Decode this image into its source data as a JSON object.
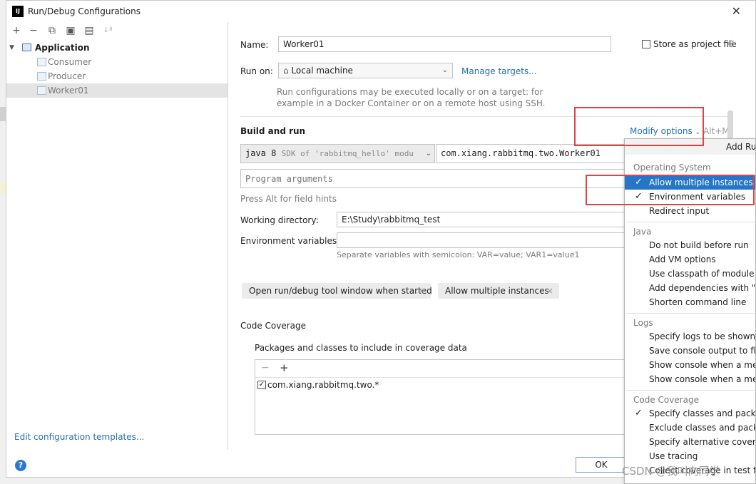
{
  "window": {
    "title": "Run/Debug Configurations",
    "app_icon_text": "IJ",
    "close": "✕"
  },
  "toolbar": {
    "add": "+",
    "remove": "−",
    "copy": "⧉",
    "save": "▣",
    "folder": "▤",
    "sort": "↓ª"
  },
  "tree": {
    "root": "Application",
    "children": [
      "Consumer",
      "Producer",
      "Worker01"
    ],
    "selected": "Worker01"
  },
  "edit_templates": "Edit configuration templates...",
  "form": {
    "name_label": "Name:",
    "name_value": "Worker01",
    "store_label": "Store as project file",
    "run_on_label": "Run on:",
    "run_on_value": "Local machine",
    "manage_targets": "Manage targets...",
    "run_on_hint_1": "Run configurations may be executed locally or on a target: for",
    "run_on_hint_2": "example in a Docker Container or on a remote host using SSH.",
    "build_run_label": "Build and run",
    "modify_options": "Modify options",
    "modify_shortcut": "Alt+M",
    "jdk_value": "java 8",
    "jdk_detail": "SDK of 'rabbitmq_hello' modu",
    "main_class": "com.xiang.rabbitmq.two.Worker01",
    "program_args_placeholder": "Program arguments",
    "alt_hint": "Press Alt for field hints",
    "working_dir_label": "Working directory:",
    "working_dir_value": "E:\\Study\\rabbitmq_test",
    "env_label": "Environment variables:",
    "env_hint": "Separate variables with semicolon: VAR=value; VAR1=value1",
    "chip_1": "Open run/debug tool window when started",
    "chip_2": "Allow multiple instances",
    "chip_close": "×",
    "code_coverage_label": "Code Coverage",
    "coverage_packages_label": "Packages and classes to include in coverage data",
    "coverage_remove": "−",
    "coverage_add": "+",
    "coverage_item": "com.xiang.rabbitmq.two.*",
    "ok": "OK",
    "help": "?"
  },
  "popup": {
    "header": "Add Run",
    "groups": [
      {
        "title": "Operating System",
        "items": [
          {
            "label": "Allow multiple instances",
            "checked": true,
            "selected": true
          },
          {
            "label": "Environment variables",
            "checked": true,
            "selected": false
          },
          {
            "label": "Redirect input",
            "checked": false,
            "selected": false
          }
        ]
      },
      {
        "title": "Java",
        "items": [
          {
            "label": "Do not build before run",
            "checked": false
          },
          {
            "label": "Add VM options",
            "checked": false
          },
          {
            "label": "Use classpath of module",
            "checked": false
          },
          {
            "label": "Add dependencies with \"pro",
            "checked": false
          },
          {
            "label": "Shorten command line",
            "checked": false
          }
        ]
      },
      {
        "title": "Logs",
        "items": [
          {
            "label": "Specify logs to be shown in c",
            "checked": false
          },
          {
            "label": "Save console output to file",
            "checked": false
          },
          {
            "label": "Show console when a messa",
            "checked": false
          },
          {
            "label": "Show console when a messa",
            "checked": false
          }
        ]
      },
      {
        "title": "Code Coverage",
        "items": [
          {
            "label": "Specify classes and packages",
            "checked": true
          },
          {
            "label": "Exclude classes and package",
            "checked": false
          },
          {
            "label": "Specify alternative coverage",
            "checked": false
          },
          {
            "label": "Use tracing",
            "checked": false
          },
          {
            "label": "Collect coverage in test folde",
            "checked": false
          }
        ]
      }
    ],
    "check_glyph": "✓"
  },
  "watermark": "CSDN @我叫向同学",
  "colors": {
    "accent": "#2675c9",
    "link": "#2470b3",
    "highlight_box": "#e04343"
  }
}
